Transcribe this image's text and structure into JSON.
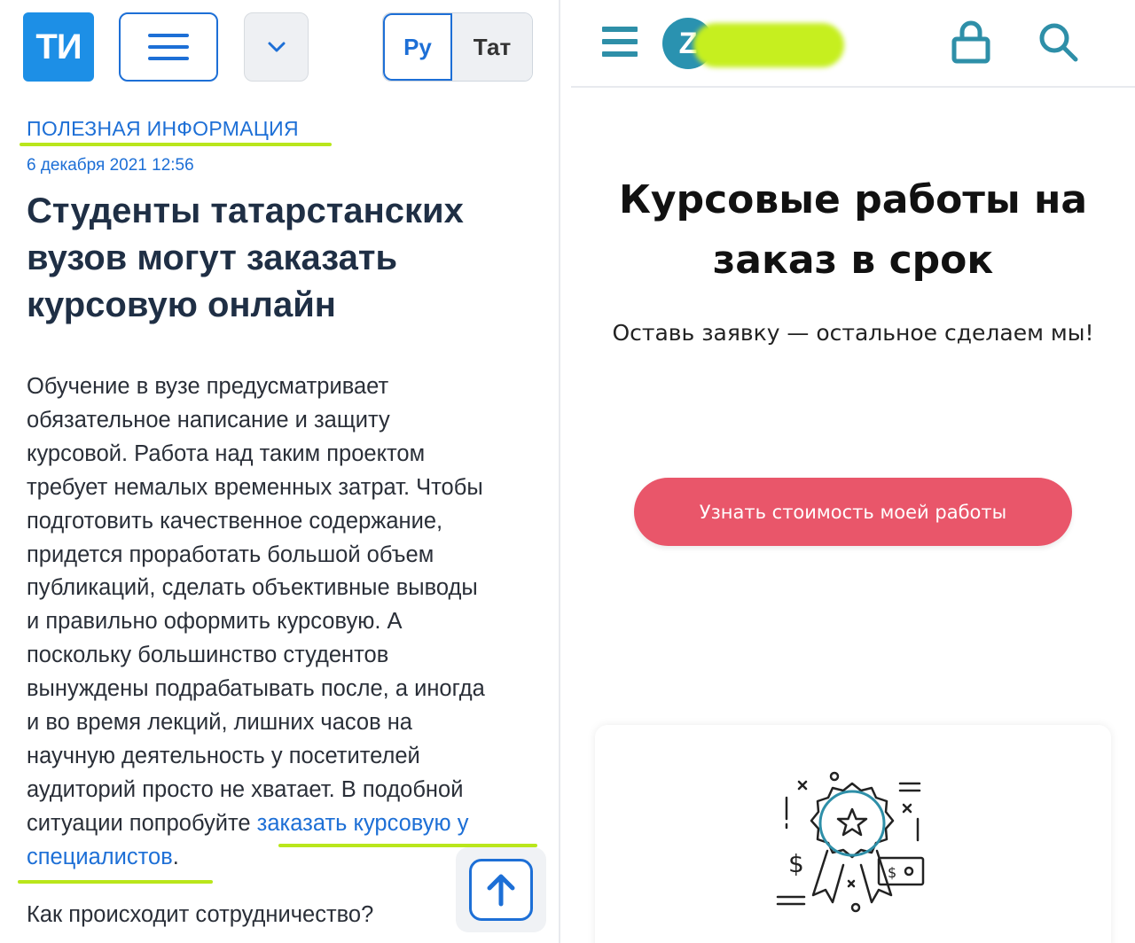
{
  "left": {
    "logo_text": "ТИ",
    "lang": {
      "ru": "Ру",
      "tat": "Тат"
    },
    "category": "ПОЛЕЗНАЯ ИНФОРМАЦИЯ",
    "date": "6 декабря 2021  12:56",
    "headline": "Студенты татарстанских вузов могут заказать курсовую онлайн",
    "body_lines": [
      "Обучение в вузе предусматривает",
      "обязательное написание и защиту",
      "курсовой. Работа над таким проектом",
      "требует немалых временных затрат. Чтобы",
      "подготовить качественное содержание,",
      "придется проработать большой объем",
      "публикаций, сделать объективные выводы",
      "и правильно оформить курсовую. А",
      "поскольку большинство студентов",
      "вынуждены подрабатывать после, а иногда",
      "и во время лекций, лишних часов на",
      "научную деятельность у посетителей",
      "аудиторий просто не хватает. В подобной"
    ],
    "body_last_prefix": "ситуации попробуйте ",
    "body_link_part1": "заказать курсовую у",
    "body_link_part2": "специалистов",
    "body_link_suffix": ".",
    "next_question": "Как происходит сотрудничество?",
    "highlight_color": "#b9e61b",
    "accent_color": "#1d6fd6"
  },
  "right": {
    "logo_letter": "Z",
    "title": "Курсовые работы на заказ в срок",
    "subtitle": "Оставь заявку — остальное сделаем мы!",
    "cta": "Узнать стоимость моей работы",
    "cta_color": "#e9566a",
    "brand_color": "#2e8fa8",
    "badge_dollar": "$"
  }
}
